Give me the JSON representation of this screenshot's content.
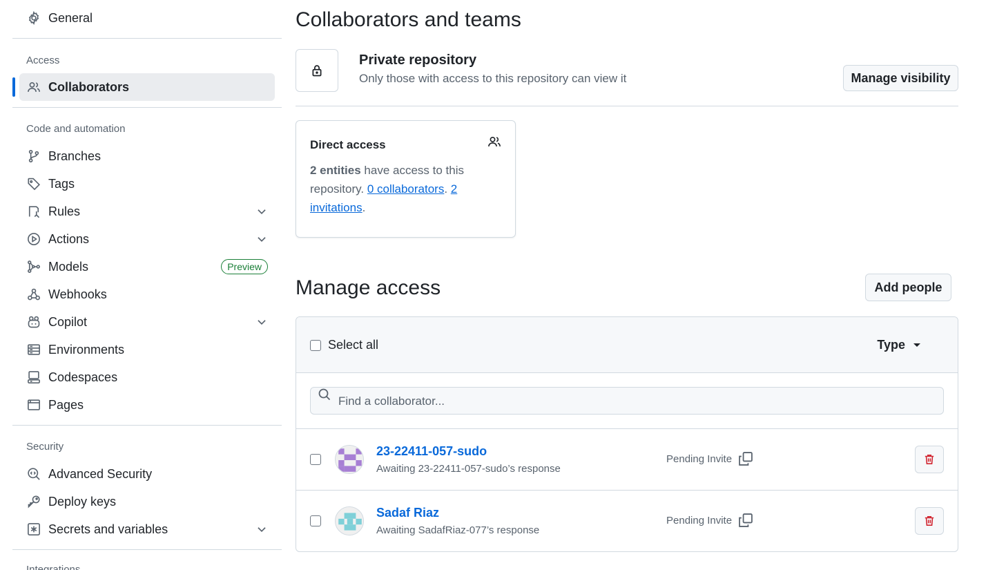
{
  "sidebar": {
    "general": "General",
    "sections": {
      "access": "Access",
      "code_automation": "Code and automation",
      "security": "Security",
      "integrations": "Integrations"
    },
    "items": {
      "collaborators": "Collaborators",
      "branches": "Branches",
      "tags": "Tags",
      "rules": "Rules",
      "actions": "Actions",
      "models": "Models",
      "models_badge": "Preview",
      "webhooks": "Webhooks",
      "copilot": "Copilot",
      "environments": "Environments",
      "codespaces": "Codespaces",
      "pages": "Pages",
      "advanced_security": "Advanced Security",
      "deploy_keys": "Deploy keys",
      "secrets": "Secrets and variables"
    }
  },
  "main": {
    "title": "Collaborators and teams",
    "repo": {
      "title": "Private repository",
      "description": "Only those with access to this repository can view it",
      "manage_visibility": "Manage visibility"
    },
    "direct_access": {
      "title": "Direct access",
      "entities": "2 entities",
      "text1": " have access to this repository. ",
      "collaborators_link": "0 collaborators",
      "sep": ". ",
      "invitations_link": "2 invitations",
      "end": "."
    },
    "manage": {
      "title": "Manage access",
      "add_people": "Add people",
      "select_all": "Select all",
      "type": "Type",
      "search_placeholder": "Find a collaborator..."
    },
    "rows": [
      {
        "name": "23-22411-057-sudo",
        "sub": "Awaiting 23-22411-057-sudo’s response",
        "status": "Pending Invite"
      },
      {
        "name": "Sadaf Riaz",
        "sub": "Awaiting SadafRiaz-077’s response",
        "status": "Pending Invite"
      }
    ]
  },
  "colors": {
    "accent": "#0969da",
    "danger": "#d1242f",
    "success": "#1a7f37"
  }
}
